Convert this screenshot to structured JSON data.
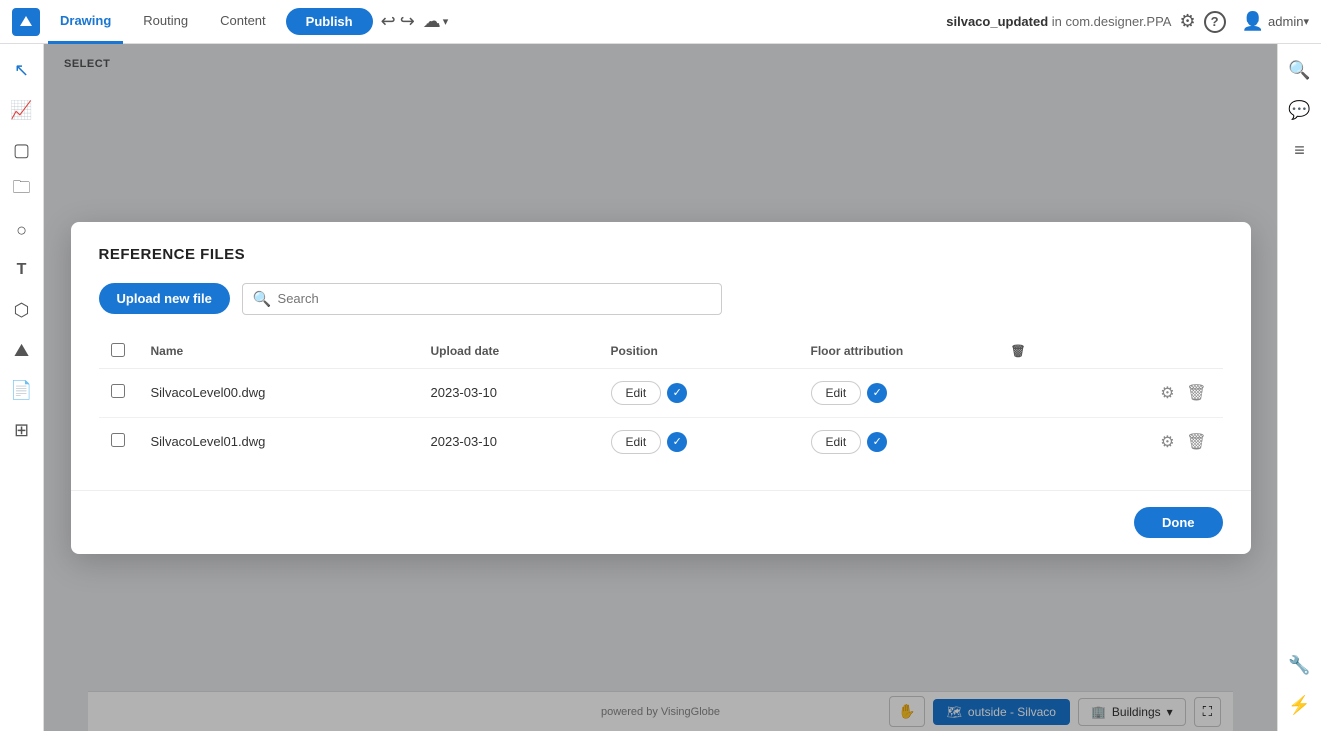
{
  "topbar": {
    "tabs": [
      {
        "id": "drawing",
        "label": "Drawing",
        "active": true
      },
      {
        "id": "routing",
        "label": "Routing",
        "active": false
      },
      {
        "id": "content",
        "label": "Content",
        "active": false
      }
    ],
    "publish_label": "Publish",
    "project_name": "silvaco_updated",
    "project_context": "in com.designer.PPA",
    "user_label": "admin"
  },
  "select_label": "SELECT",
  "modal": {
    "title": "REFERENCE FILES",
    "upload_btn": "Upload new file",
    "search_placeholder": "Search",
    "table": {
      "headers": [
        "",
        "Name",
        "Upload date",
        "Position",
        "Floor attribution",
        ""
      ],
      "rows": [
        {
          "id": "row-0",
          "name": "SilvacoLevel00.dwg",
          "upload_date": "2023-03-10",
          "position_edit": "Edit",
          "position_checked": true,
          "floor_edit": "Edit",
          "floor_checked": true
        },
        {
          "id": "row-1",
          "name": "SilvacoLevel01.dwg",
          "upload_date": "2023-03-10",
          "position_edit": "Edit",
          "position_checked": true,
          "floor_edit": "Edit",
          "floor_checked": true
        }
      ]
    },
    "done_label": "Done"
  },
  "bottom_bar": {
    "powered_text": "powered by VisingGlobe",
    "location_label": "outside - Silvaco",
    "buildings_label": "Buildings"
  },
  "icons": {
    "search": "🔍",
    "undo": "↩",
    "redo": "↪",
    "cloud": "☁",
    "settings": "⚙",
    "help": "?",
    "user": "👤",
    "cursor": "↖",
    "line": "⟋",
    "square": "▢",
    "folder": "🗀",
    "circle": "○",
    "text": "T",
    "cube": "⬡",
    "landscape": "⛰",
    "doc": "📄",
    "layers": "⊞",
    "wrench": "🔧",
    "lightning": "⚡",
    "zoom": "⛶",
    "chat": "💬",
    "list": "≡",
    "hand": "✋",
    "expand": "⛶",
    "trash": "🗑",
    "gear": "⚙"
  }
}
